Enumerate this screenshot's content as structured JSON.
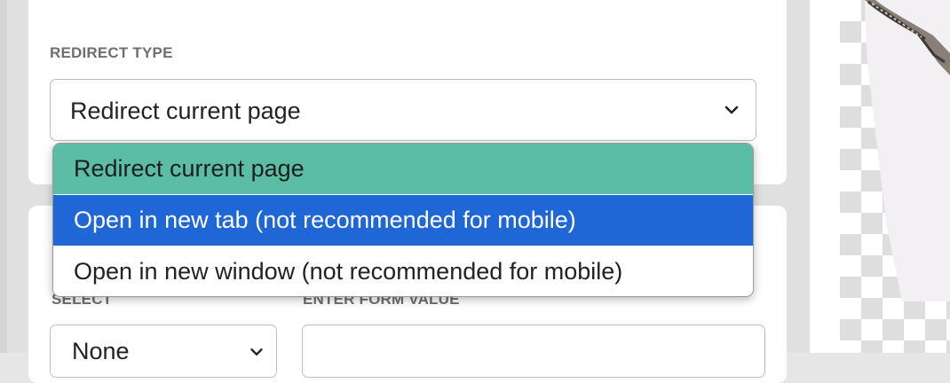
{
  "redirect": {
    "label": "REDIRECT TYPE",
    "selected_value": "Redirect current page",
    "options": [
      "Redirect current page",
      "Open in new tab (not recommended for mobile)",
      "Open in new window (not recommended for mobile)"
    ],
    "option_colors": {
      "selected": "#5bbea4",
      "hovered": "#1f66d6"
    }
  },
  "form": {
    "select_label": "SELECT",
    "value_label": "ENTER FORM VALUE",
    "select_value": "None"
  },
  "icons": {
    "dropdown": "chevron-down-icon"
  }
}
